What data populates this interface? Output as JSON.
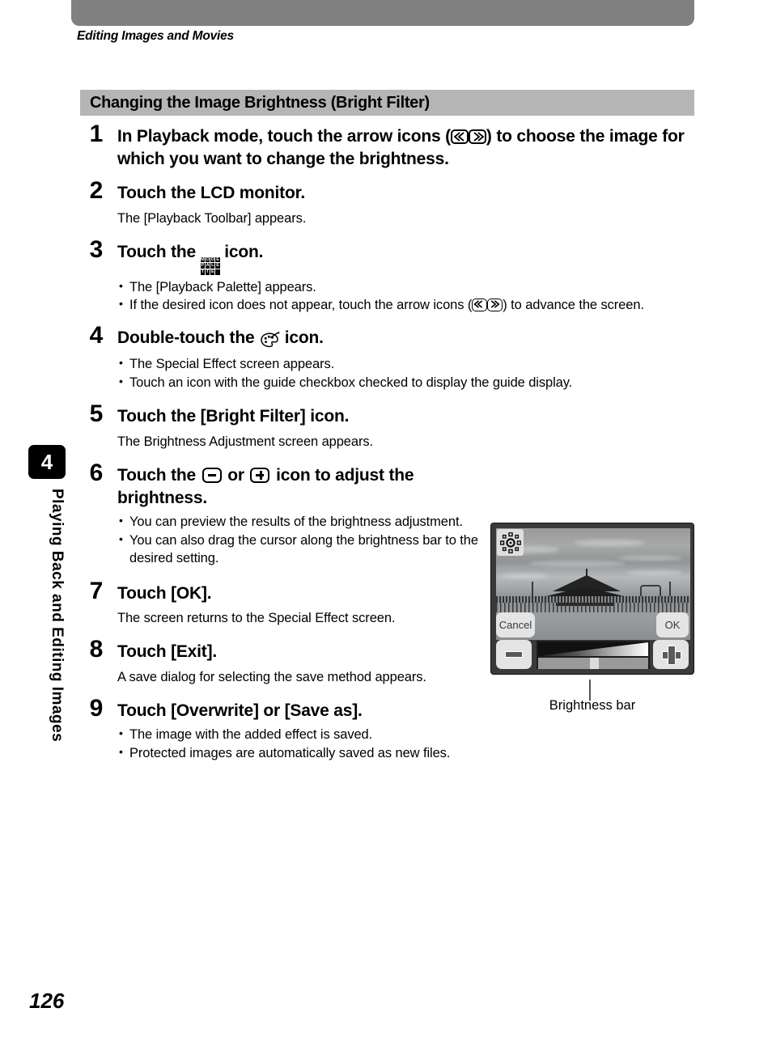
{
  "header": {
    "running_head": "Editing Images and Movies",
    "bar_color": "#808080"
  },
  "section": {
    "heading": "Changing the Image Brightness (Bright Filter)",
    "heading_bg": "#b5b5b5"
  },
  "side_tab": {
    "chapter_number": "4",
    "chapter_title": "Playing Back and Editing Images"
  },
  "steps": [
    {
      "number": "1",
      "title_before": "In Playback mode, touch the arrow icons (",
      "title_after": ") to choose the image for which you want to change the brightness.",
      "icons": [
        "arrow-left-icon",
        "arrow-right-icon"
      ],
      "desc": "",
      "bullets": []
    },
    {
      "number": "2",
      "title": "Touch the LCD monitor.",
      "desc": "The [Playback Toolbar] appears.",
      "bullets": []
    },
    {
      "number": "3",
      "title_before": "Touch the ",
      "title_after": " icon.",
      "icons": [
        "mode-palette-icon"
      ],
      "desc": "",
      "bullets": [
        "The [Playback Palette] appears.",
        "If the desired icon does not appear, touch the arrow icons (« ») to advance the screen."
      ],
      "bullet2_before": "If the desired icon does not appear, touch the arrow icons (",
      "bullet2_after": ") to advance the screen."
    },
    {
      "number": "4",
      "title_before": "Double-touch the ",
      "title_after": " icon.",
      "icons": [
        "paint-palette-icon"
      ],
      "desc": "",
      "bullets": [
        "The Special Effect screen appears.",
        "Touch an icon with the guide checkbox checked to display the guide display."
      ]
    },
    {
      "number": "5",
      "title": "Touch the [Bright Filter] icon.",
      "desc": "The Brightness Adjustment screen appears.",
      "bullets": []
    },
    {
      "number": "6",
      "title_before": "Touch the ",
      "title_mid": " or ",
      "title_after": " icon to adjust the brightness.",
      "icons": [
        "minus-icon",
        "plus-icon"
      ],
      "desc": "",
      "bullets": [
        "You can preview the results of the brightness adjustment.",
        "You can also drag the cursor along the brightness bar to the desired setting."
      ]
    },
    {
      "number": "7",
      "title": "Touch [OK].",
      "desc": "The screen returns to the Special Effect screen.",
      "bullets": []
    },
    {
      "number": "8",
      "title": "Touch [Exit].",
      "desc": "A save dialog for selecting the save method appears.",
      "bullets": []
    },
    {
      "number": "9",
      "title": "Touch [Overwrite] or [Save as].",
      "desc": "",
      "bullets": [
        "The image with the added effect is saved.",
        "Protected images are automatically saved as new files."
      ]
    }
  ],
  "figure": {
    "caption": "Brightness bar",
    "lcd": {
      "badge_icon": "brightness-sun-icon",
      "cancel_label": "Cancel",
      "ok_label": "OK",
      "minus_icon": "minus-icon",
      "plus_icon": "plus-icon",
      "cursor_position_pct": "47"
    }
  },
  "footer": {
    "page_number": "126"
  },
  "icon_glyphs": {
    "mode_palette_letters": [
      "M",
      "O",
      "D",
      "E",
      "P",
      "A",
      "L",
      "E",
      "T",
      "T",
      "E",
      ""
    ]
  }
}
